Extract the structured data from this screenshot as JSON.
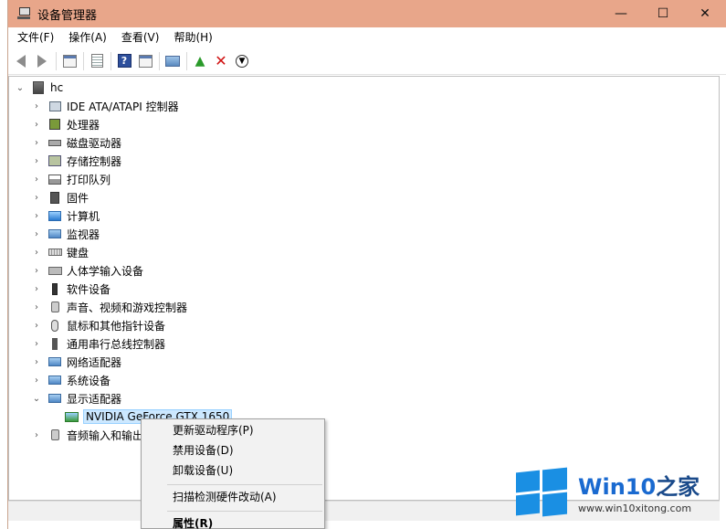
{
  "window": {
    "title": "设备管理器",
    "controls": {
      "minimize": "—",
      "maximize": "☐",
      "close": "✕"
    }
  },
  "menubar": {
    "items": [
      "文件(F)",
      "操作(A)",
      "查看(V)",
      "帮助(H)"
    ]
  },
  "tree": {
    "root": "hc",
    "categories": [
      {
        "label": "IDE ATA/ATAPI 控制器",
        "icon": "ide-controller-icon",
        "expanded": false
      },
      {
        "label": "处理器",
        "icon": "processor-icon",
        "expanded": false
      },
      {
        "label": "磁盘驱动器",
        "icon": "disk-drive-icon",
        "expanded": false
      },
      {
        "label": "存储控制器",
        "icon": "storage-controller-icon",
        "expanded": false
      },
      {
        "label": "打印队列",
        "icon": "printer-icon",
        "expanded": false
      },
      {
        "label": "固件",
        "icon": "firmware-icon",
        "expanded": false
      },
      {
        "label": "计算机",
        "icon": "computer-icon",
        "expanded": false
      },
      {
        "label": "监视器",
        "icon": "monitor-icon",
        "expanded": false
      },
      {
        "label": "键盘",
        "icon": "keyboard-icon",
        "expanded": false
      },
      {
        "label": "人体学输入设备",
        "icon": "hid-icon",
        "expanded": false
      },
      {
        "label": "软件设备",
        "icon": "software-device-icon",
        "expanded": false
      },
      {
        "label": "声音、视频和游戏控制器",
        "icon": "speaker-icon",
        "expanded": false
      },
      {
        "label": "鼠标和其他指针设备",
        "icon": "mouse-icon",
        "expanded": false
      },
      {
        "label": "通用串行总线控制器",
        "icon": "usb-icon",
        "expanded": false
      },
      {
        "label": "网络适配器",
        "icon": "network-adapter-icon",
        "expanded": false
      },
      {
        "label": "系统设备",
        "icon": "system-device-icon",
        "expanded": false
      },
      {
        "label": "显示适配器",
        "icon": "display-adapter-icon",
        "expanded": true
      }
    ],
    "display_child": "NVIDIA GeForce GTX 1650",
    "audio_partial": "音频输入和输出"
  },
  "context_menu": {
    "update_driver": "更新驱动程序(P)",
    "disable_device": "禁用设备(D)",
    "uninstall_device": "卸载设备(U)",
    "scan_hardware": "扫描检测硬件改动(A)",
    "properties": "属性(R)"
  },
  "watermark": {
    "brand_prefix": "Win10",
    "brand_suffix": "之家",
    "url": "www.win10xitong.com",
    "color": "#1a8fe3"
  },
  "colors": {
    "titlebar": "#e8a68a",
    "selection": "#cce8ff"
  }
}
